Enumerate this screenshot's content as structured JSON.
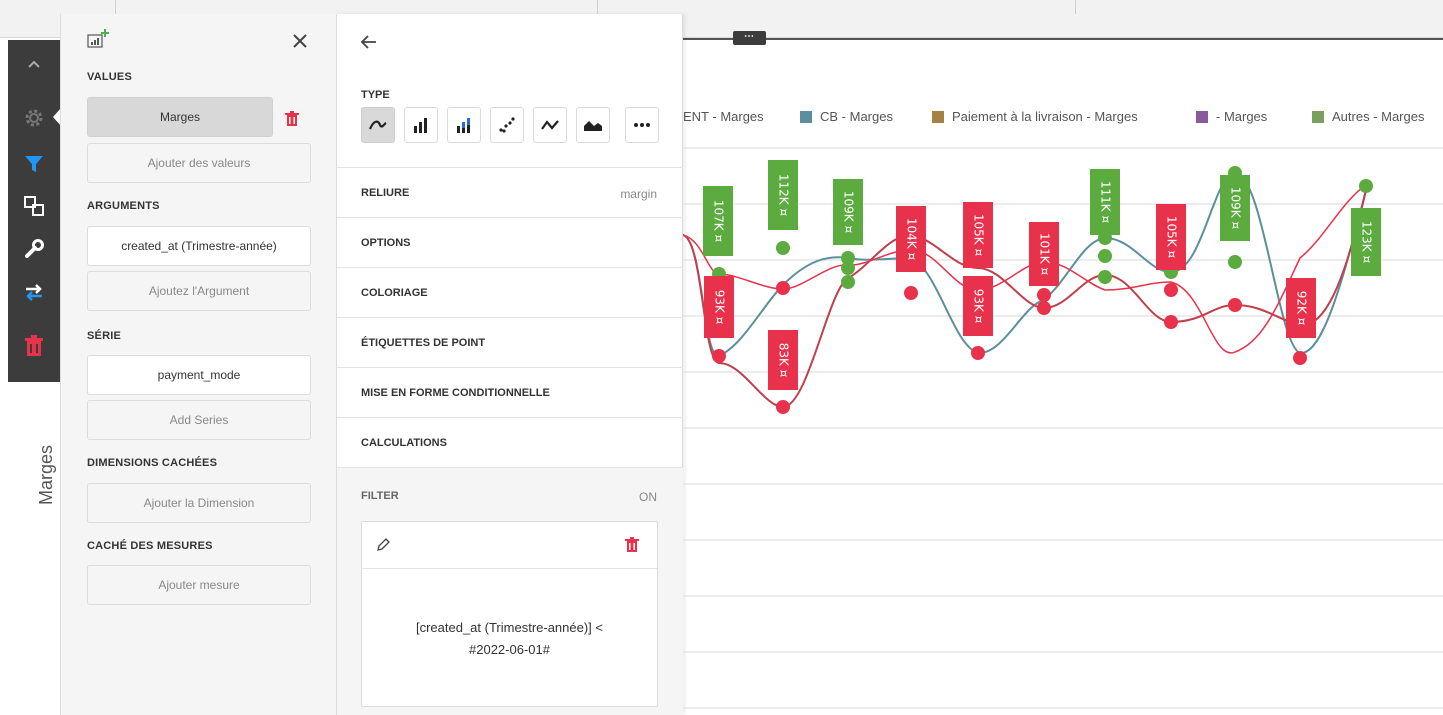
{
  "binding_panel": {
    "values_title": "VALUES",
    "values_item": "Marges",
    "values_add": "Ajouter des valeurs",
    "arguments_title": "ARGUMENTS",
    "arguments_item": "created_at (Trimestre-année)",
    "arguments_add": "Ajoutez l'Argument",
    "series_title": "SÉRIE",
    "series_item": "payment_mode",
    "series_add": "Add Series",
    "hidden_dims_title": "DIMENSIONS CACHÉES",
    "hidden_dims_add": "Ajouter la Dimension",
    "hidden_measures_title": "CACHÉ DES MESURES",
    "hidden_measures_add": "Ajouter mesure"
  },
  "options_panel": {
    "type_label": "TYPE",
    "chart_types": [
      "spline",
      "bar",
      "stacked-bar",
      "scatter",
      "line",
      "area",
      "more"
    ],
    "active_type": "spline",
    "rows": [
      {
        "label": "RELIURE",
        "value": "margin"
      },
      {
        "label": "OPTIONS",
        "value": ""
      },
      {
        "label": "COLORIAGE",
        "value": ""
      },
      {
        "label": "ÉTIQUETTES DE POINT",
        "value": ""
      },
      {
        "label": "MISE EN FORME CONDITIONNELLE",
        "value": ""
      },
      {
        "label": "CALCULATIONS",
        "value": ""
      }
    ],
    "filter_label": "FILTER",
    "filter_state": "ON",
    "filter_expression_line1": "[created_at (Trimestre-année)] <",
    "filter_expression_line2": "#2022-06-01#"
  },
  "axis_title": "Marges",
  "legend": [
    {
      "label": "ENT - Marges",
      "color": "#e8314b",
      "swatch": false
    },
    {
      "label": "CB - Marges",
      "color": "#5b8f9f"
    },
    {
      "label": "Paiement à la livraison - Marges",
      "color": "#a58242"
    },
    {
      "label": "- Marges",
      "color": "#8a5a9b"
    },
    {
      "label": "Autres - Marges",
      "color": "#7aa05f"
    }
  ],
  "colors": {
    "red": "#e8314b",
    "green": "#5cab3f",
    "teal": "#5b8f9f",
    "dark_red": "#c0404c",
    "toolbar_bg": "#3c3c3c",
    "filter_blue": "#2196f3",
    "delete_red": "#e8314b"
  },
  "chart_labels": {
    "green": [
      "107K ¤",
      "112K ¤",
      "109K ¤",
      "111K ¤",
      "109K ¤",
      "123K ¤"
    ],
    "red": [
      "93K ¤",
      "83K ¤",
      "104K ¤",
      "105K ¤",
      "93K ¤",
      "101K ¤",
      "105K ¤",
      "92K ¤"
    ]
  }
}
